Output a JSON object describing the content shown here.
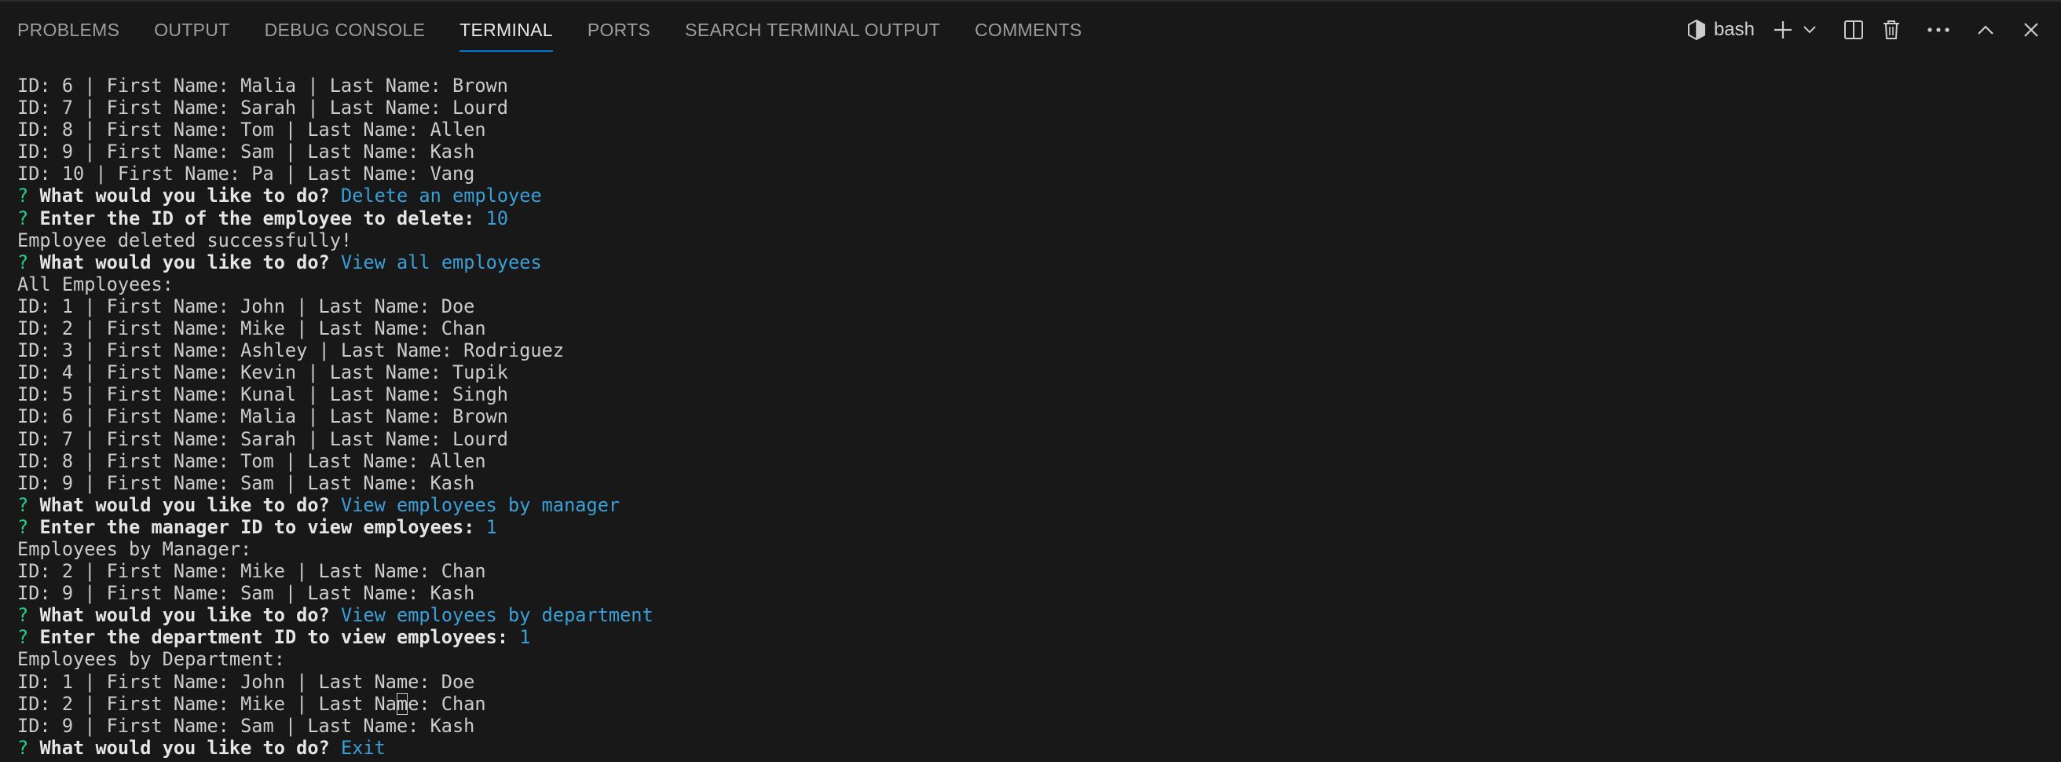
{
  "tabs": [
    {
      "label": "PROBLEMS",
      "active": false
    },
    {
      "label": "OUTPUT",
      "active": false
    },
    {
      "label": "DEBUG CONSOLE",
      "active": false
    },
    {
      "label": "TERMINAL",
      "active": true
    },
    {
      "label": "PORTS",
      "active": false
    },
    {
      "label": "SEARCH TERMINAL OUTPUT",
      "active": false
    },
    {
      "label": "COMMENTS",
      "active": false
    }
  ],
  "toolbar": {
    "shell_label": "bash",
    "icons": [
      "terminal-shell-icon",
      "plus-icon",
      "chevron-down-icon",
      "split-editor-icon",
      "trash-icon",
      "ellipsis-icon",
      "chevron-up-icon",
      "close-icon"
    ]
  },
  "colors": {
    "background": "#181818",
    "text": "#cccccc",
    "prompt_mark": "#23d18b",
    "answer": "#3b9fd8",
    "active_tab_underline": "#0078d4"
  },
  "terminal": {
    "lines": [
      {
        "type": "text",
        "text": "ID: 6 | First Name: Malia | Last Name: Brown"
      },
      {
        "type": "text",
        "text": "ID: 7 | First Name: Sarah | Last Name: Lourd"
      },
      {
        "type": "text",
        "text": "ID: 8 | First Name: Tom | Last Name: Allen"
      },
      {
        "type": "text",
        "text": "ID: 9 | First Name: Sam | Last Name: Kash"
      },
      {
        "type": "text",
        "text": "ID: 10 | First Name: Pa | Last Name: Vang"
      },
      {
        "type": "prompt",
        "mark": "?",
        "question": "What would you like to do?",
        "answer": "Delete an employee"
      },
      {
        "type": "prompt",
        "mark": "?",
        "question": "Enter the ID of the employee to delete:",
        "answer": "10"
      },
      {
        "type": "text",
        "text": "Employee deleted successfully!"
      },
      {
        "type": "prompt",
        "mark": "?",
        "question": "What would you like to do?",
        "answer": "View all employees"
      },
      {
        "type": "text",
        "text": "All Employees:"
      },
      {
        "type": "text",
        "text": "ID: 1 | First Name: John | Last Name: Doe"
      },
      {
        "type": "text",
        "text": "ID: 2 | First Name: Mike | Last Name: Chan"
      },
      {
        "type": "text",
        "text": "ID: 3 | First Name: Ashley | Last Name: Rodriguez"
      },
      {
        "type": "text",
        "text": "ID: 4 | First Name: Kevin | Last Name: Tupik"
      },
      {
        "type": "text",
        "text": "ID: 5 | First Name: Kunal | Last Name: Singh"
      },
      {
        "type": "text",
        "text": "ID: 6 | First Name: Malia | Last Name: Brown"
      },
      {
        "type": "text",
        "text": "ID: 7 | First Name: Sarah | Last Name: Lourd"
      },
      {
        "type": "text",
        "text": "ID: 8 | First Name: Tom | Last Name: Allen"
      },
      {
        "type": "text",
        "text": "ID: 9 | First Name: Sam | Last Name: Kash"
      },
      {
        "type": "prompt",
        "mark": "?",
        "question": "What would you like to do?",
        "answer": "View employees by manager"
      },
      {
        "type": "prompt",
        "mark": "?",
        "question": "Enter the manager ID to view employees:",
        "answer": "1"
      },
      {
        "type": "text",
        "text": "Employees by Manager:"
      },
      {
        "type": "text",
        "text": "ID: 2 | First Name: Mike | Last Name: Chan"
      },
      {
        "type": "text",
        "text": "ID: 9 | First Name: Sam | Last Name: Kash"
      },
      {
        "type": "prompt",
        "mark": "?",
        "question": "What would you like to do?",
        "answer": "View employees by department"
      },
      {
        "type": "prompt",
        "mark": "?",
        "question": "Enter the department ID to view employees:",
        "answer": "1"
      },
      {
        "type": "text",
        "text": "Employees by Department:"
      },
      {
        "type": "text",
        "text": "ID: 1 | First Name: John | Last Name: Doe"
      },
      {
        "type": "text",
        "text": "ID: 2 | First Name: Mike | Last Name: Chan",
        "cursor_char": "m"
      },
      {
        "type": "text",
        "text": "ID: 9 | First Name: Sam | Last Name: Kash"
      },
      {
        "type": "prompt",
        "mark": "?",
        "question": "What would you like to do?",
        "answer": "Exit"
      }
    ]
  }
}
